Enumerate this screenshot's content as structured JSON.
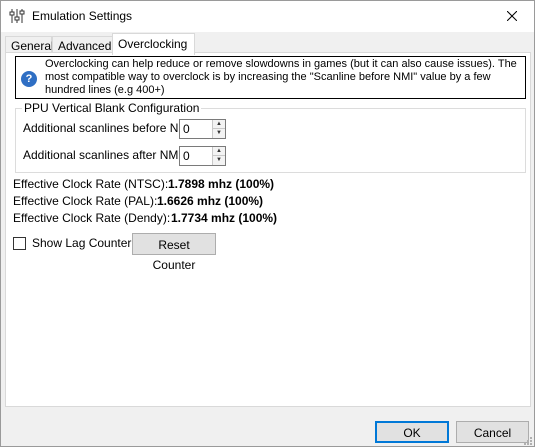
{
  "window": {
    "title": "Emulation Settings",
    "close_icon": "close-icon",
    "app_icon": "sliders-icon"
  },
  "tabs": [
    {
      "label": "General",
      "active": false
    },
    {
      "label": "Advanced",
      "active": false
    },
    {
      "label": "Overclocking",
      "active": true
    }
  ],
  "info": {
    "icon": "help-icon",
    "text": "Overclocking can help reduce or remove slowdowns in games (but it can also cause issues). The most compatible way to overclock is by increasing the \"Scanline before NMI\" value by a few hundred lines (e.g 400+)"
  },
  "ppu_group": {
    "title": "PPU Vertical Blank Configuration",
    "before_nmi": {
      "label": "Additional scanlines before NMI:",
      "value": "0"
    },
    "after_nmi": {
      "label": "Additional scanlines after NMI:",
      "value": "0"
    }
  },
  "clock_rates": [
    {
      "label": "Effective Clock Rate (NTSC):",
      "value": "1.7898 mhz (100%)"
    },
    {
      "label": "Effective Clock Rate (PAL):",
      "value": "1.6626 mhz (100%)"
    },
    {
      "label": "Effective Clock Rate (Dendy):",
      "value": "1.7734 mhz (100%)"
    }
  ],
  "lag_counter": {
    "checkbox_label": "Show Lag Counter",
    "checked": false,
    "reset_label": "Reset Counter"
  },
  "footer": {
    "ok_label": "OK",
    "cancel_label": "Cancel"
  },
  "colors": {
    "accent": "#0078d7",
    "panel_bg": "#ffffff",
    "window_bg": "#f0f0f0"
  }
}
